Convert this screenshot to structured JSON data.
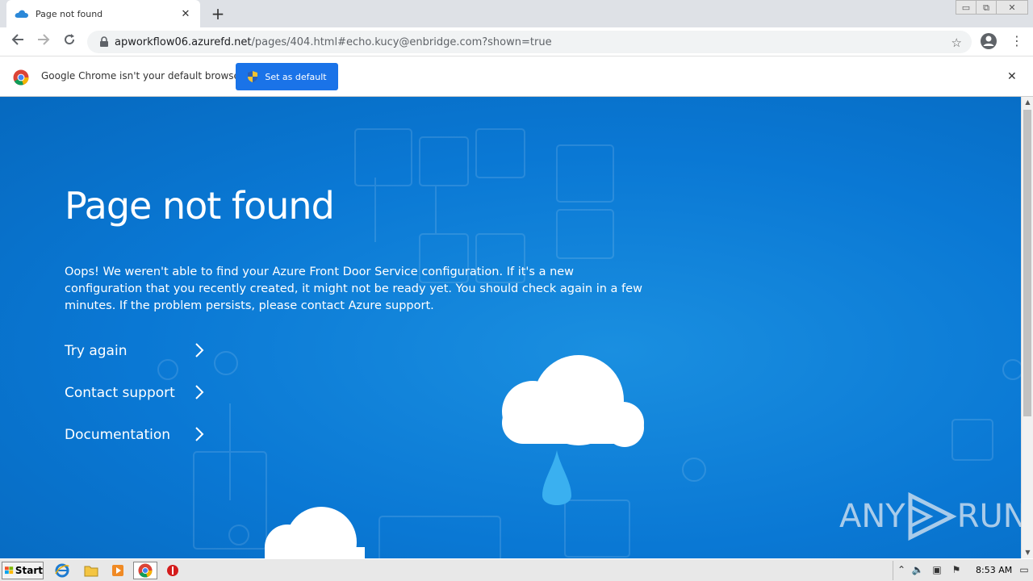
{
  "browser": {
    "tab_title": "Page not found",
    "tab_close": "✕",
    "new_tab": "+",
    "url_host": "apworkflow06.azurefd.net",
    "url_rest": "/pages/404.html#echo.kucy@enbridge.com?shown=true",
    "star": "☆",
    "menu": "⋮"
  },
  "window_controls": {
    "minimize": "▭",
    "restore": "⧉",
    "close": "✕"
  },
  "infobar": {
    "message": "Google Chrome isn't your default browser",
    "button_label": "Set as default",
    "close": "✕"
  },
  "page": {
    "title": "Page not found",
    "description": "Oops! We weren't able to find your Azure Front Door Service configuration. If it's a new configuration that you recently created, it might not be ready yet. You should check again in a few minutes. If the problem persists, please contact Azure support.",
    "links": [
      "Try again",
      "Contact support",
      "Documentation"
    ],
    "background_color": "#0a78d4"
  },
  "watermark": {
    "text_left": "ANY",
    "text_right": "RUN"
  },
  "taskbar": {
    "start_label": "Start",
    "clock": "8:53 AM"
  },
  "icons": [
    "cloud-favicon-icon",
    "lock-icon",
    "star-icon",
    "profile-icon",
    "chrome-logo-icon",
    "shield-icon",
    "chevron-right-icon",
    "ie-icon",
    "folder-icon",
    "media-player-icon",
    "chrome-icon",
    "stop-icon"
  ]
}
